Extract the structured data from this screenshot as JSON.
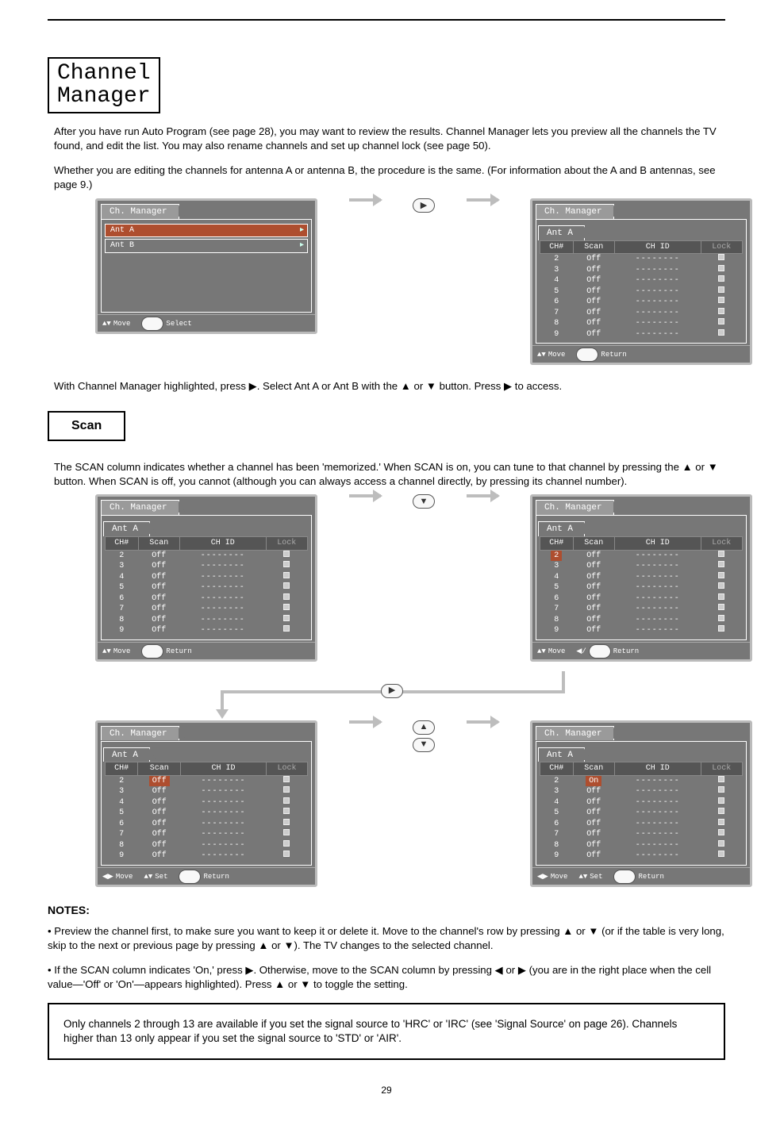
{
  "pageRule": true,
  "title": {
    "line1": "Channel",
    "line2": "Manager"
  },
  "intro": [
    "After you have run Auto Program (see page 28), you may want to review the results. Channel Manager lets you preview all the channels the TV found, and edit the list. You may also rename channels and set up channel lock (see page 50).",
    "Whether you are editing the channels for antenna A or antenna B, the procedure is the same. (For information about the A and B antennas, see page 9.)"
  ],
  "menuPanel": {
    "tab": "Ch. Manager",
    "items": [
      {
        "label": "Ant A",
        "highlight": true
      },
      {
        "label": "Ant B",
        "highlight": false
      }
    ],
    "hints": {
      "move": "Move",
      "action": "Select"
    }
  },
  "tablePanel": {
    "tab": "Ch. Manager",
    "subtab": "Ant A",
    "cols": {
      "ch": "CH#",
      "scan": "Scan",
      "chid": "CH ID",
      "lock": "Lock"
    },
    "rows": [
      {
        "ch": "2",
        "scan": "Off",
        "chid": "--------"
      },
      {
        "ch": "3",
        "scan": "Off",
        "chid": "--------"
      },
      {
        "ch": "4",
        "scan": "Off",
        "chid": "--------"
      },
      {
        "ch": "5",
        "scan": "Off",
        "chid": "--------"
      },
      {
        "ch": "6",
        "scan": "Off",
        "chid": "--------"
      },
      {
        "ch": "7",
        "scan": "Off",
        "chid": "--------"
      },
      {
        "ch": "8",
        "scan": "Off",
        "chid": "--------"
      },
      {
        "ch": "9",
        "scan": "Off",
        "chid": "--------"
      }
    ],
    "scanOn": "On",
    "hintsReturn": {
      "move": "Move",
      "action": "Return"
    },
    "hintsSet": {
      "move": "Move",
      "set": "Set",
      "action": "Return"
    }
  },
  "afterStep1": "With Channel Manager highlighted, press ▶. Select Ant A or Ant B with the ▲ or ▼ button. Press ▶ to access.",
  "scanHeading": "Scan",
  "scanLead": "The SCAN column indicates whether a channel has been 'memorized.' When SCAN is on, you can tune to that channel by pressing the ▲ or ▼ button. When SCAN is off, you cannot (although you can always access a channel directly, by pressing its channel number).",
  "notesLabel": "NOTES:",
  "notes": [
    "• Preview the channel first, to make sure you want to keep it or delete it. Move to the channel's row by pressing ▲ or ▼ (or if the table is very long, skip to the next or previous page by pressing ▲ or ▼). The TV changes to the selected channel.",
    "• If the SCAN column indicates 'On,' press ▶. Otherwise, move to the SCAN column by pressing ◀ or ▶ (you are in the right place when the cell value—'Off' or 'On'—appears highlighted). Press ▲ or ▼ to toggle the setting."
  ],
  "noteBox": "Only channels 2 through 13 are available if you set the signal source to 'HRC' or 'IRC' (see 'Signal Source' on page 26). Channels higher than 13 only appear if you set the signal source to 'STD' or 'AIR'.",
  "pageNumber": "29"
}
